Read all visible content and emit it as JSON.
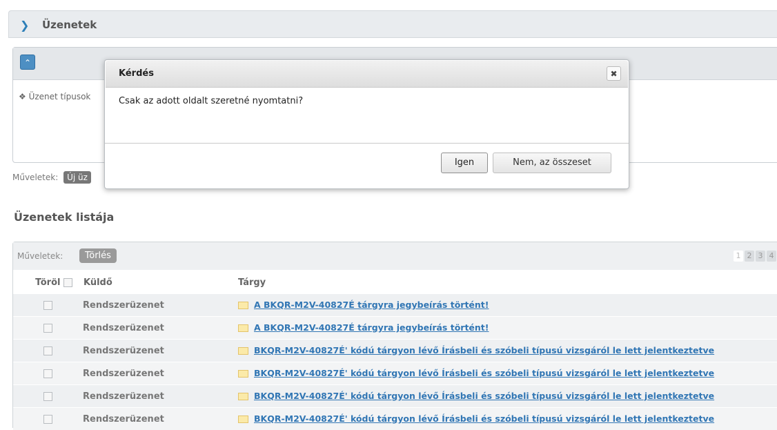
{
  "panel": {
    "title": "Üzenetek"
  },
  "filter": {
    "message_types_label": "Üzenet típusok",
    "operations_label": "Műveletek:",
    "new_button": "Új üz"
  },
  "list": {
    "title": "Üzenetek listája",
    "operations_label": "Műveletek:",
    "delete_button": "Törlés",
    "pager": [
      "1",
      "2",
      "3",
      "4"
    ],
    "headers": {
      "delete": "Töröl",
      "sender": "Küldő",
      "subject": "Tárgy"
    },
    "rows": [
      {
        "sender": "Rendszerüzenet",
        "subject": "A BKQR-M2V-40827É tárgyra jegybeírás történt!"
      },
      {
        "sender": "Rendszerüzenet",
        "subject": "A BKQR-M2V-40827É tárgyra jegybeírás történt!"
      },
      {
        "sender": "Rendszerüzenet",
        "subject": "BKQR-M2V-40827É' kódú tárgyon lévő Írásbeli és szóbeli típusú vizsgáról le lett jelentkeztetve"
      },
      {
        "sender": "Rendszerüzenet",
        "subject": "BKQR-M2V-40827É' kódú tárgyon lévő Írásbeli és szóbeli típusú vizsgáról le lett jelentkeztetve"
      },
      {
        "sender": "Rendszerüzenet",
        "subject": "BKQR-M2V-40827É' kódú tárgyon lévő Írásbeli és szóbeli típusú vizsgáról le lett jelentkeztetve"
      },
      {
        "sender": "Rendszerüzenet",
        "subject": "BKQR-M2V-40827É' kódú tárgyon lévő Írásbeli és szóbeli típusú vizsgáról le lett jelentkeztetve"
      }
    ]
  },
  "dialog": {
    "title": "Kérdés",
    "close_glyph": "✖",
    "message": "Csak az adott oldalt szeretné nyomtatni?",
    "yes_button": "Igen",
    "no_button": "Nem, az összeset"
  }
}
